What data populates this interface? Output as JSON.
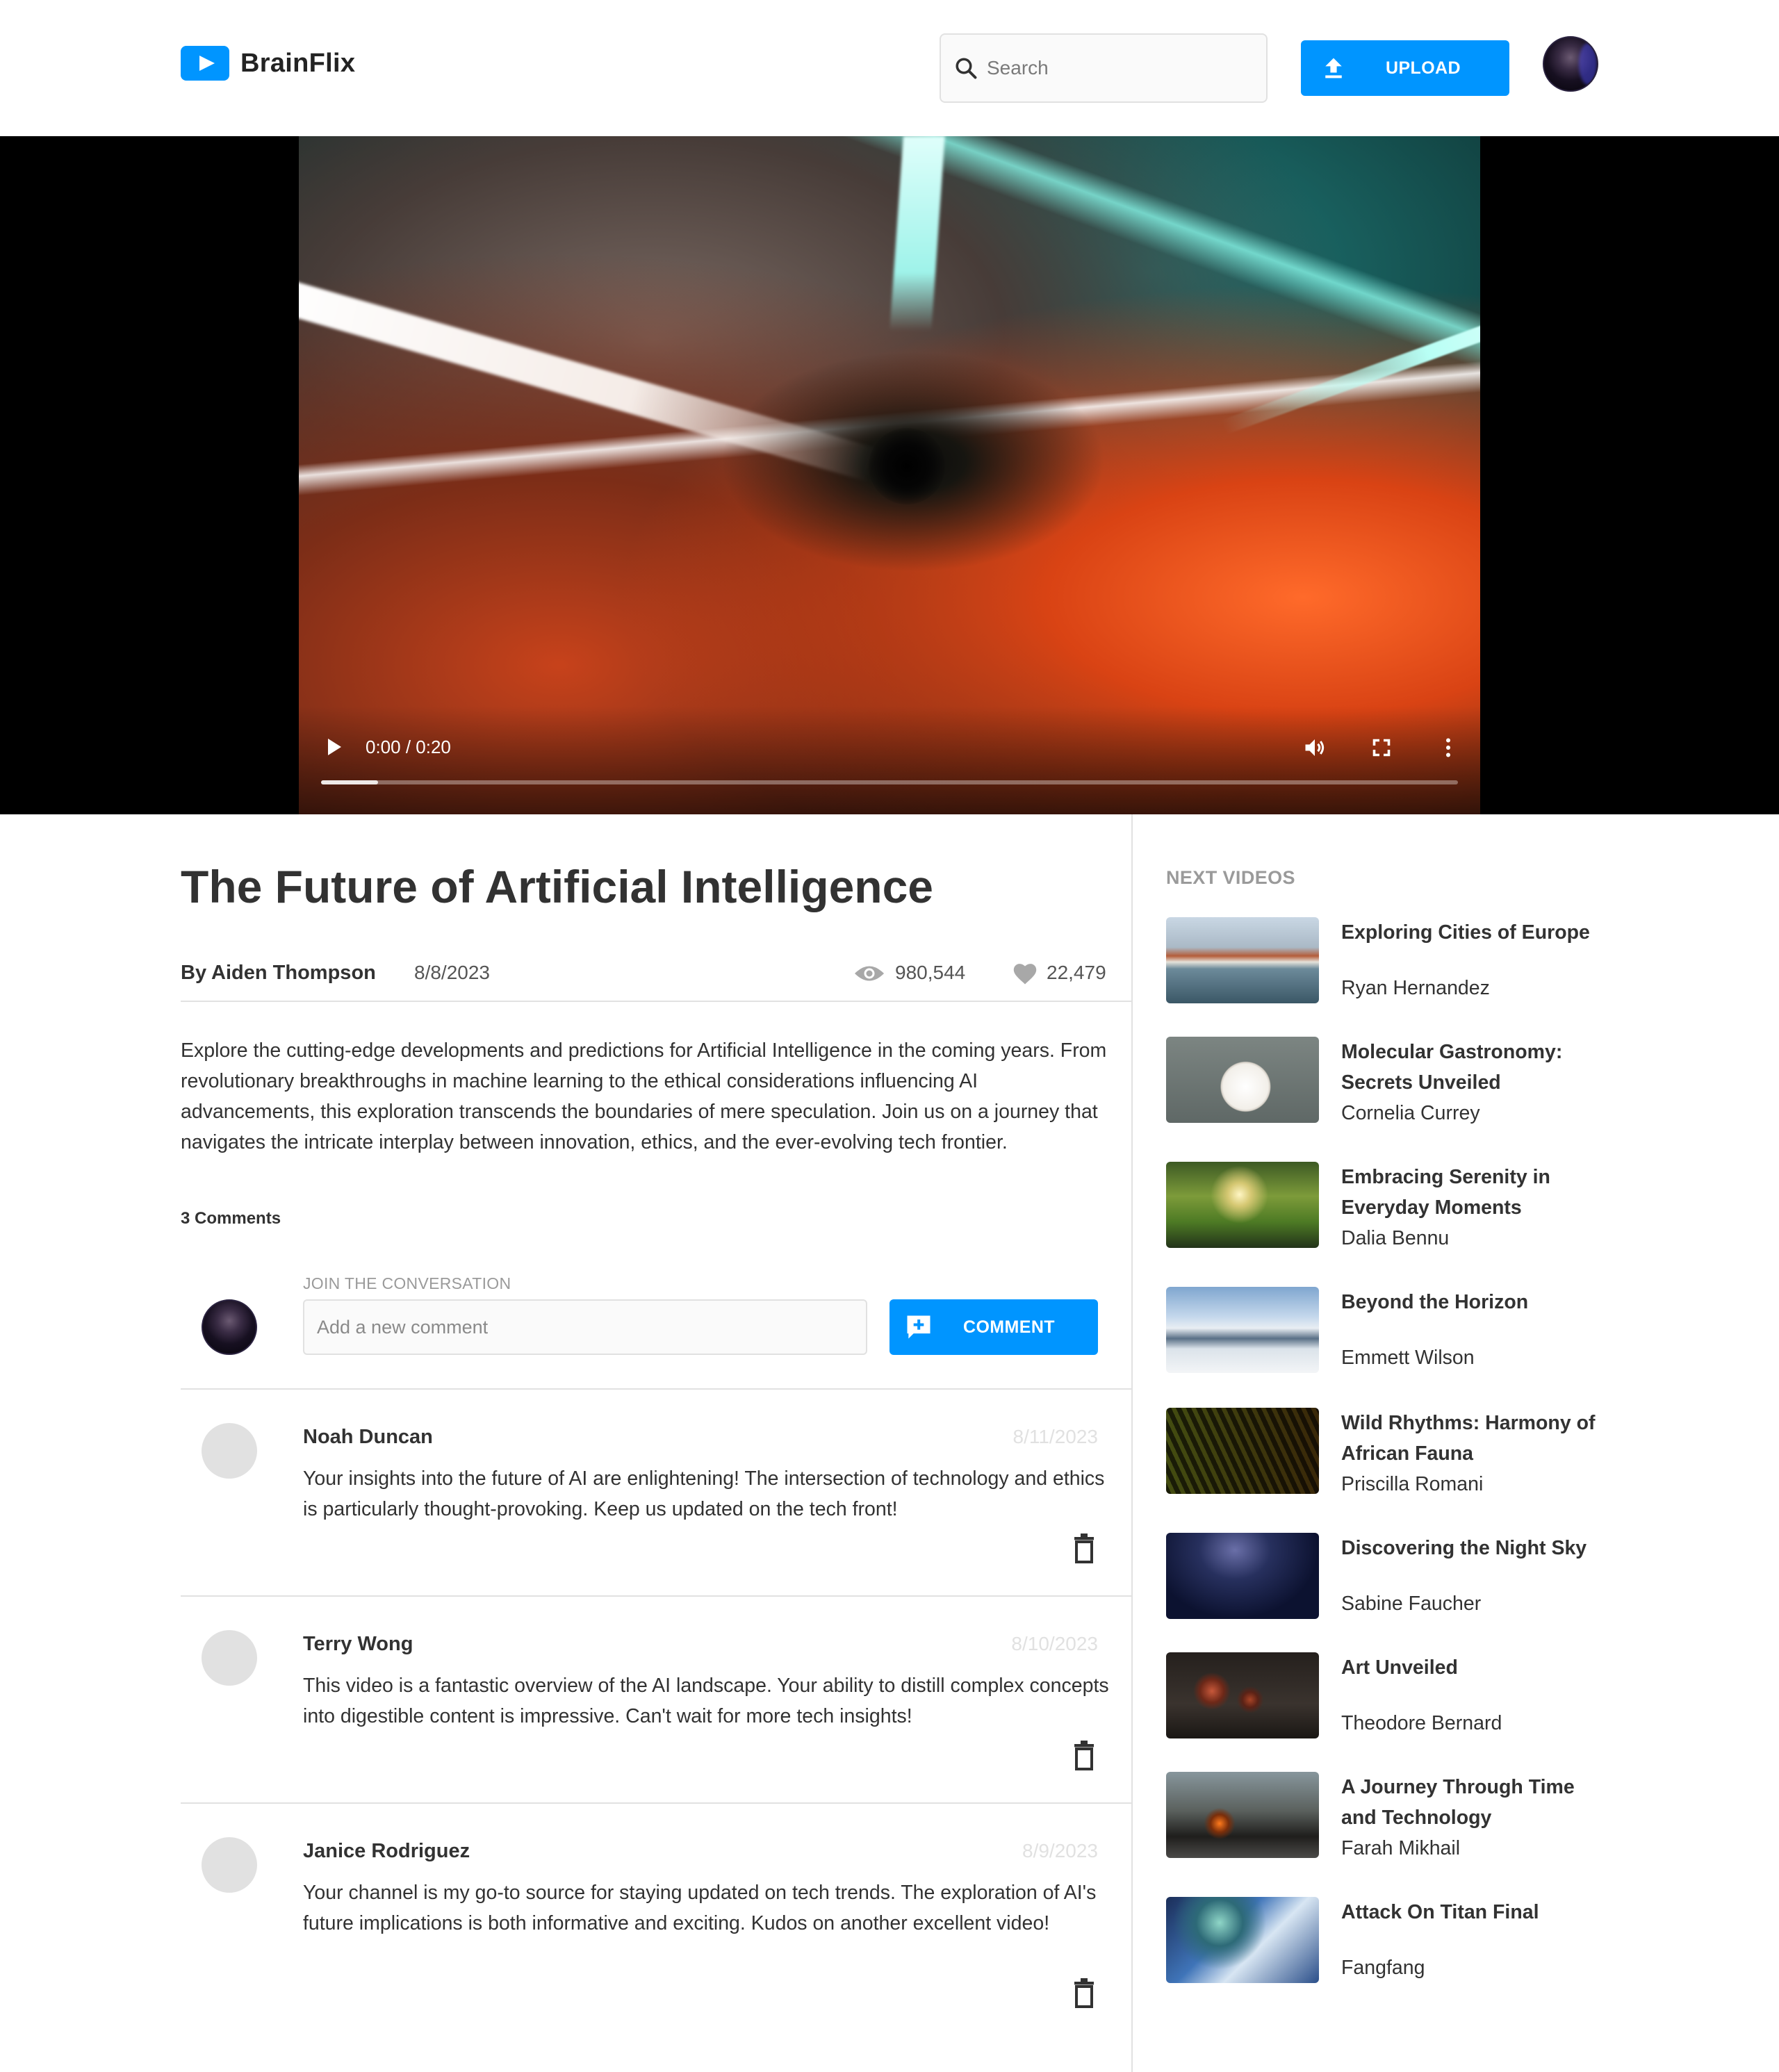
{
  "app": {
    "name": "BrainFlix"
  },
  "header": {
    "search_placeholder": "Search",
    "upload_label": "UPLOAD"
  },
  "video": {
    "time": "0:00 / 0:20",
    "progress_buffered_fraction": 0.05,
    "title": "The Future of Artificial Intelligence",
    "author": "By Aiden Thompson",
    "date": "8/8/2023",
    "views": "980,544",
    "likes": "22,479",
    "description": "Explore the cutting-edge developments and predictions for Artificial Intelligence in the coming years. From revolutionary breakthroughs in machine learning to the ethical considerations influencing AI advancements, this exploration transcends the boundaries of mere speculation. Join us on a journey that navigates the intricate interplay between innovation, ethics, and the ever-evolving tech frontier."
  },
  "comments": {
    "count_label": "3 Comments",
    "form_label": "JOIN THE CONVERSATION",
    "input_placeholder": "Add a new comment",
    "button_label": "COMMENT",
    "items": [
      {
        "name": "Noah Duncan",
        "date": "8/11/2023",
        "text": "Your insights into the future of AI are enlightening! The intersection of technology and ethics is particularly thought-provoking. Keep us updated on the tech front!"
      },
      {
        "name": "Terry Wong",
        "date": "8/10/2023",
        "text": "This video is a fantastic overview of the AI landscape. Your ability to distill complex concepts into digestible content is impressive. Can't wait for more tech insights!"
      },
      {
        "name": "Janice Rodriguez",
        "date": "8/9/2023",
        "text": "Your channel is my go-to source for staying updated on tech trends. The exploration of AI's future implications is both informative and exciting. Kudos on another excellent video!"
      }
    ]
  },
  "sidebar": {
    "heading": "NEXT VIDEOS",
    "items": [
      {
        "title": "Exploring Cities of Europe",
        "channel": "Ryan Hernandez"
      },
      {
        "title": "Molecular Gastronomy: Secrets Unveiled",
        "channel": "Cornelia Currey"
      },
      {
        "title": "Embracing Serenity in Everyday Moments",
        "channel": "Dalia Bennu"
      },
      {
        "title": "Beyond the Horizon",
        "channel": "Emmett Wilson"
      },
      {
        "title": "Wild Rhythms: Harmony of African Fauna",
        "channel": "Priscilla Romani"
      },
      {
        "title": "Discovering the Night Sky",
        "channel": "Sabine Faucher"
      },
      {
        "title": "Art Unveiled",
        "channel": "Theodore Bernard"
      },
      {
        "title": "A Journey Through Time and Technology",
        "channel": "Farah Mikhail"
      },
      {
        "title": "Attack On Titan Final",
        "channel": "Fangfang"
      }
    ]
  },
  "icons": {
    "logo": "play-icon",
    "search": "search-icon",
    "upload": "upload-icon",
    "play": "play-icon",
    "volume": "volume-icon",
    "fullscreen": "fullscreen-icon",
    "more": "more-vertical-icon",
    "views": "eye-icon",
    "likes": "heart-icon",
    "add_comment": "add-comment-icon",
    "delete": "trash-icon"
  },
  "colors": {
    "accent": "#0095ff",
    "text": "#323232",
    "muted": "#9a9a9a",
    "border": "#e1e1e1"
  }
}
